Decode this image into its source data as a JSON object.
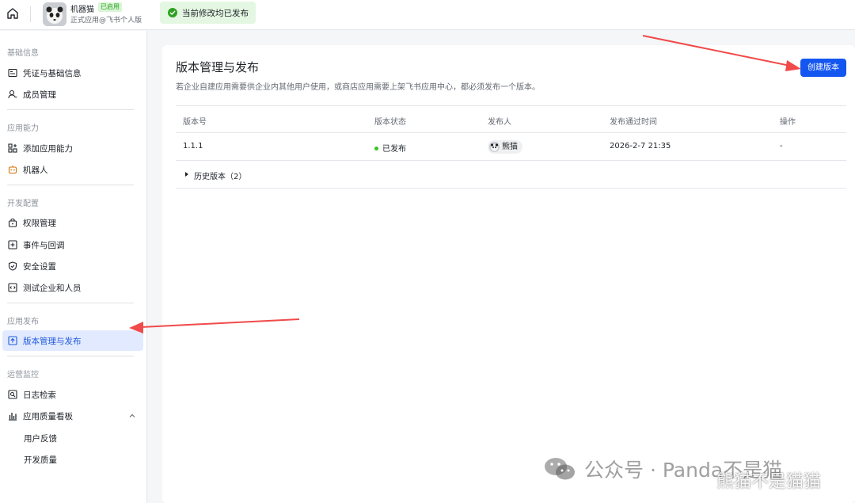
{
  "header": {
    "app_name": "机器猫",
    "app_badge": "已启用",
    "app_sub": "正式应用@飞书个人版",
    "notice": "当前修改均已发布"
  },
  "sidebar": {
    "sections": [
      {
        "title": "基础信息",
        "items": [
          {
            "label": "凭证与基础信息",
            "icon": "credential-icon"
          },
          {
            "label": "成员管理",
            "icon": "member-icon"
          }
        ]
      },
      {
        "title": "应用能力",
        "items": [
          {
            "label": "添加应用能力",
            "icon": "grid-add-icon"
          },
          {
            "label": "机器人",
            "icon": "robot-icon"
          }
        ]
      },
      {
        "title": "开发配置",
        "items": [
          {
            "label": "权限管理",
            "icon": "lock-icon"
          },
          {
            "label": "事件与回调",
            "icon": "event-icon"
          },
          {
            "label": "安全设置",
            "icon": "shield-icon"
          },
          {
            "label": "测试企业和人员",
            "icon": "code-icon"
          }
        ]
      },
      {
        "title": "应用发布",
        "items": [
          {
            "label": "版本管理与发布",
            "icon": "upload-icon",
            "active": true
          }
        ]
      },
      {
        "title": "运营监控",
        "items": [
          {
            "label": "日志检索",
            "icon": "log-search-icon"
          },
          {
            "label": "应用质量看板",
            "icon": "bar-chart-icon",
            "expanded": true
          },
          {
            "label": "用户反馈"
          },
          {
            "label": "开发质量"
          }
        ]
      }
    ]
  },
  "main": {
    "title": "版本管理与发布",
    "description": "若企业自建应用需要供企业内其他用户使用，或商店应用需要上架飞书应用中心，都必须发布一个版本。",
    "create_button": "创建版本",
    "table": {
      "columns": [
        "版本号",
        "版本状态",
        "发布人",
        "发布通过时间",
        "操作"
      ],
      "rows": [
        {
          "version": "1.1.1",
          "status": "已发布",
          "publisher": "熊猫",
          "time": "2026-2-7 21:35",
          "action": "-"
        }
      ],
      "history": "历史版本（2）"
    }
  },
  "watermark": {
    "text": "公众号 · Panda不是猫",
    "overlay": "熊猫不是猫猫"
  },
  "colors": {
    "accent": "#1456f0",
    "active_bg": "#e1eaff",
    "success": "#34c724",
    "annotation_arrow": "#f04a4a"
  }
}
